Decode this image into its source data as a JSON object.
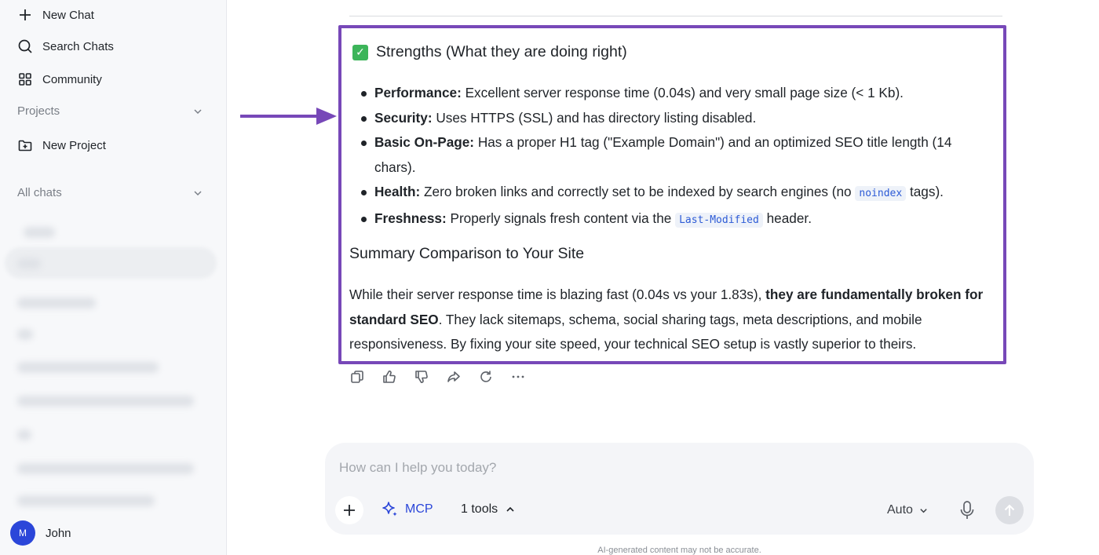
{
  "sidebar": {
    "new_chat": "New Chat",
    "search_chats": "Search Chats",
    "community": "Community",
    "projects_label": "Projects",
    "new_project": "New Project",
    "all_chats_label": "All chats",
    "user": {
      "initial": "M",
      "name": "John"
    }
  },
  "message": {
    "strengths_heading": "Strengths (What they are doing right)",
    "bullets": [
      {
        "label": "Performance:",
        "text": " Excellent server response time (0.04s) and very small page size (< 1 Kb)."
      },
      {
        "label": "Security:",
        "text": " Uses HTTPS (SSL) and has directory listing disabled."
      },
      {
        "label": "Basic On-Page:",
        "text": " Has a proper H1 tag (\"Example Domain\") and an optimized SEO title length (14 chars)."
      },
      {
        "label": "Health:",
        "text_before": " Zero broken links and correctly set to be indexed by search engines (no ",
        "code": "noindex",
        "text_after": " tags)."
      },
      {
        "label": "Freshness:",
        "text_before": " Properly signals fresh content via the ",
        "code": "Last-Modified",
        "text_after": " header."
      }
    ],
    "summary_heading": "Summary Comparison to Your Site",
    "summary_before": "While their server response time is blazing fast (0.04s vs your 1.83s), ",
    "summary_bold": "they are fundamentally broken for standard SEO",
    "summary_after": ". They lack sitemaps, schema, social sharing tags, meta descriptions, and mobile responsiveness. By fixing your site speed, your technical SEO setup is vastly superior to theirs."
  },
  "actions": [
    "copy-icon",
    "thumbs-up-icon",
    "thumbs-down-icon",
    "share-icon",
    "regenerate-icon",
    "more-icon"
  ],
  "composer": {
    "placeholder": "How can I help you today?",
    "mcp_label": "MCP",
    "tools_label": "1 tools",
    "model_label": "Auto"
  },
  "disclaimer": "AI-generated content may not be accurate.",
  "colors": {
    "highlight_border": "#7748b8",
    "accent": "#2b46d9",
    "check": "#3cb55a"
  }
}
